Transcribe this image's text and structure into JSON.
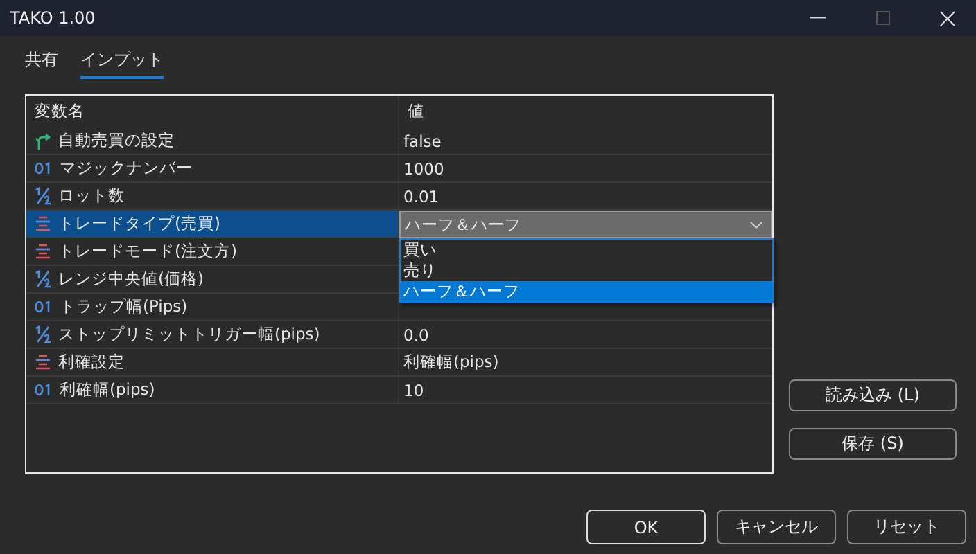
{
  "window": {
    "title": "TAKO 1.00"
  },
  "tabs": [
    {
      "label": "共有",
      "selected": false
    },
    {
      "label": "インプット",
      "selected": true
    }
  ],
  "table": {
    "columns": [
      "変数名",
      "値"
    ],
    "rows": [
      {
        "kind": "bool",
        "name": "自動売買の設定",
        "value": "false",
        "selected": false
      },
      {
        "kind": "int",
        "name": "マジックナンバー",
        "value": "1000",
        "selected": false
      },
      {
        "kind": "double",
        "name": "ロット数",
        "value": "0.01",
        "selected": false
      },
      {
        "kind": "enum",
        "name": "トレードタイプ(売買)",
        "value": "ハーフ＆ハーフ",
        "selected": true,
        "expanded": true,
        "options": [
          {
            "label": "買い",
            "selected": false
          },
          {
            "label": "売り",
            "selected": false
          },
          {
            "label": "ハーフ＆ハーフ",
            "selected": true
          }
        ]
      },
      {
        "kind": "enum",
        "name": "トレードモード(注文方)",
        "selected": false
      },
      {
        "kind": "double",
        "name": "レンジ中央値(価格)",
        "selected": false
      },
      {
        "kind": "int",
        "name": "トラップ幅(Pips)",
        "selected": false
      },
      {
        "kind": "double",
        "name": "ストップリミットトリガー幅(pips)",
        "value": "0.0",
        "selected": false
      },
      {
        "kind": "enum",
        "name": "利確設定",
        "value": "利確幅(pips)",
        "selected": false
      },
      {
        "kind": "int",
        "name": "利確幅(pips)",
        "value": "10",
        "selected": false
      }
    ]
  },
  "side_buttons": [
    "読み込み (L)",
    "保存 (S)"
  ],
  "buttons": [
    "OK",
    "キャンセル",
    "リセット"
  ]
}
